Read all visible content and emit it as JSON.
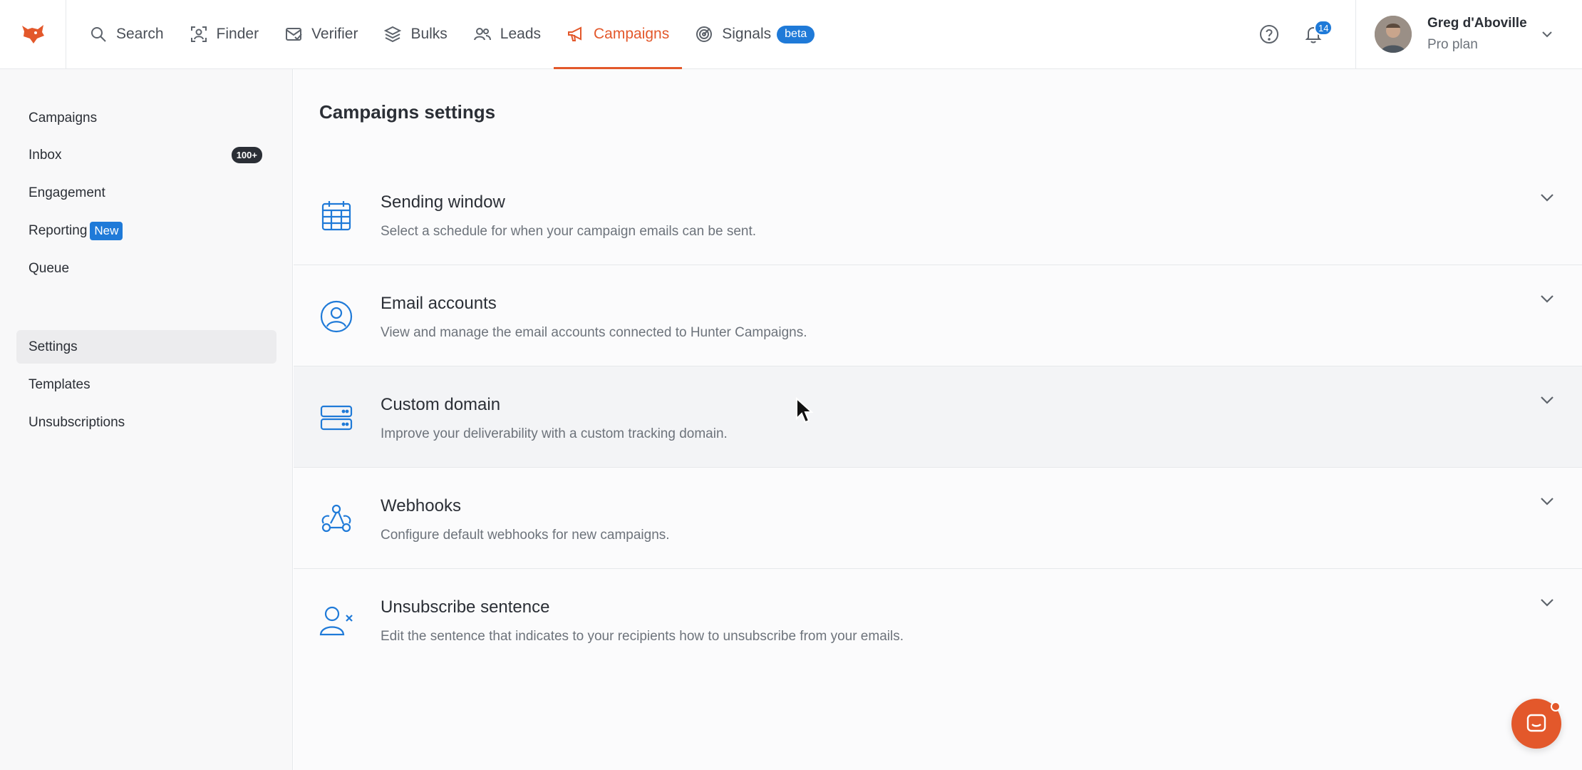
{
  "colors": {
    "brand": "#e3582b",
    "accent_blue": "#1f7ad8",
    "text": "#2b2f36",
    "muted": "#6d737b"
  },
  "header": {
    "logo_icon": "fox-logo-icon",
    "nav": [
      {
        "label": "Search",
        "icon": "search-icon",
        "active": false
      },
      {
        "label": "Finder",
        "icon": "finder-icon",
        "active": false
      },
      {
        "label": "Verifier",
        "icon": "verifier-icon",
        "active": false
      },
      {
        "label": "Bulks",
        "icon": "layers-icon",
        "active": false
      },
      {
        "label": "Leads",
        "icon": "users-icon",
        "active": false
      },
      {
        "label": "Campaigns",
        "icon": "megaphone-icon",
        "active": true
      },
      {
        "label": "Signals",
        "icon": "radar-icon",
        "active": false,
        "badge": "beta"
      }
    ],
    "help_icon": "help-circle-icon",
    "notifications": {
      "icon": "bell-icon",
      "count": "14"
    },
    "user": {
      "name": "Greg d'Aboville",
      "plan": "Pro plan"
    }
  },
  "sidebar": {
    "items": [
      {
        "label": "Campaigns"
      },
      {
        "label": "Inbox",
        "badge": "100+"
      },
      {
        "label": "Engagement"
      },
      {
        "label": "Reporting",
        "badge": "New"
      },
      {
        "label": "Queue"
      },
      {
        "label": "Settings",
        "active": true
      },
      {
        "label": "Templates"
      },
      {
        "label": "Unsubscriptions"
      }
    ]
  },
  "main": {
    "title": "Campaigns settings",
    "sections": [
      {
        "title": "Sending window",
        "description": "Select a schedule for when your campaign emails can be sent.",
        "icon": "calendar-icon"
      },
      {
        "title": "Email accounts",
        "description": "View and manage the email accounts connected to Hunter Campaigns.",
        "icon": "user-circle-icon"
      },
      {
        "title": "Custom domain",
        "description": "Improve your deliverability with a custom tracking domain.",
        "icon": "server-icon"
      },
      {
        "title": "Webhooks",
        "description": "Configure default webhooks for new campaigns.",
        "icon": "webhook-icon"
      },
      {
        "title": "Unsubscribe sentence",
        "description": "Edit the sentence that indicates to your recipients how to unsubscribe from your emails.",
        "icon": "user-x-icon"
      }
    ]
  },
  "chat_widget": {
    "icon": "chat-icon"
  }
}
